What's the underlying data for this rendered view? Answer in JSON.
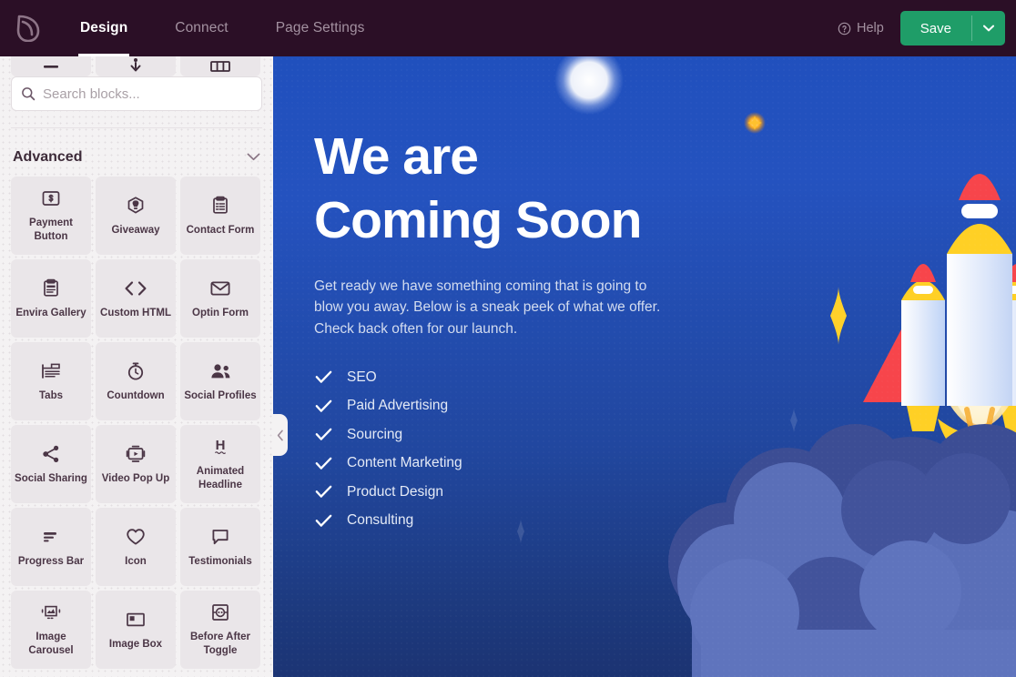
{
  "topbar": {
    "brand_icon": "leaf-logo-icon",
    "nav": [
      {
        "label": "Design",
        "active": true
      },
      {
        "label": "Connect",
        "active": false
      },
      {
        "label": "Page Settings",
        "active": false
      }
    ],
    "help_label": "Help",
    "help_icon": "question-circle-icon",
    "save_label": "Save",
    "save_caret_icon": "chevron-down-icon",
    "save_color": "#1f9d68",
    "background_color": "#2b0f26"
  },
  "sidebar": {
    "search": {
      "placeholder": "Search blocks...",
      "value": "",
      "icon": "search-icon"
    },
    "section": {
      "title": "Advanced",
      "chevron_icon": "chevron-down-icon",
      "expanded": true
    },
    "background_color": "#f4f2f3",
    "partial_tiles": [
      {
        "icon": "divider-icon"
      },
      {
        "icon": "anchor-icon"
      },
      {
        "icon": "columns-icon"
      }
    ],
    "tiles": [
      {
        "label": "Payment Button",
        "icon": "dollar-square-icon"
      },
      {
        "label": "Giveaway",
        "icon": "gift-badge-icon"
      },
      {
        "label": "Contact Form",
        "icon": "form-clipboard-icon"
      },
      {
        "label": "Envira Gallery",
        "icon": "gallery-clipboard-icon"
      },
      {
        "label": "Custom HTML",
        "icon": "code-brackets-icon"
      },
      {
        "label": "Optin Form",
        "icon": "envelope-icon"
      },
      {
        "label": "Tabs",
        "icon": "tabs-icon"
      },
      {
        "label": "Countdown",
        "icon": "stopwatch-icon"
      },
      {
        "label": "Social Profiles",
        "icon": "users-icon"
      },
      {
        "label": "Social Sharing",
        "icon": "share-nodes-icon"
      },
      {
        "label": "Video Pop Up",
        "icon": "video-play-icon"
      },
      {
        "label": "Animated Headline",
        "icon": "animated-h-icon"
      },
      {
        "label": "Progress Bar",
        "icon": "progress-bars-icon"
      },
      {
        "label": "Icon",
        "icon": "heart-icon"
      },
      {
        "label": "Testimonials",
        "icon": "speech-bubble-icon"
      },
      {
        "label": "Image Carousel",
        "icon": "image-carousel-icon"
      },
      {
        "label": "Image Box",
        "icon": "image-box-icon"
      },
      {
        "label": "Before After Toggle",
        "icon": "before-after-icon"
      }
    ]
  },
  "collapse_handle": {
    "icon": "chevron-left-icon"
  },
  "canvas": {
    "headline": "We are\nComing Soon",
    "subtext": "Get ready we have something coming that is going to\nblow you away. Below is a sneak peek of what we offer.\nCheck back often for our launch.",
    "features": [
      "SEO",
      "Paid Advertising",
      "Sourcing",
      "Content Marketing",
      "Product Design",
      "Consulting"
    ],
    "check_icon": "check-icon",
    "colors": {
      "bg_top": "#2050bd",
      "bg_bottom": "#1b3270",
      "heading": "#ffffff",
      "body": "#d3dcef",
      "rocket_nose": "#f7454b",
      "rocket_body_yellow": "#ffd025",
      "rocket_body_light": "#dbe6fb",
      "cloud_light": "#5a6fb8",
      "cloud_dark": "#3e4f96",
      "moon": "#ffffff",
      "star_gold": "#ffd02a"
    }
  }
}
